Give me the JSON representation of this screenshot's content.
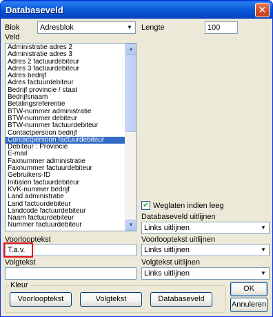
{
  "window": {
    "title": "Databaseveld",
    "close_symbol": "✕"
  },
  "blok": {
    "label": "Blok",
    "value": "Adresblok"
  },
  "lengte": {
    "label": "Lengte",
    "value": "100"
  },
  "veld": {
    "label": "Veld",
    "items": [
      "Administratie adres 2",
      "Administratie adres 3",
      "Adres 2 factuurdebiteur",
      "Adres 3 factuurdebiteur",
      "Adres bedrijf",
      "Adres factuurdebiteur",
      "Bedrijf provincie / staat",
      "Bedrijfsnaam",
      "Betalingsreferentie",
      "BTW-nummer administratie",
      "BTW-nummer debiteur",
      "BTW-nummer factuurdebiteur",
      "Contactpersoon bedrijf",
      "Contactpersoon factuurdebiteur",
      "Debiteur : Provincie",
      "E-mail",
      "Faxnummer administratie",
      "Faxnummer factuurdebiteur",
      "Gebruikers-ID",
      "Initialen factuurdebiteur",
      "KVK-nummer bedrijf",
      "Land administratie",
      "Land factuurdebiteur",
      "Landcode factuurdebiteur",
      "Naam factuurdebiteur",
      "Nummer factuurdebiteur"
    ],
    "selected_index": 13
  },
  "weglaten": {
    "label": "Weglaten indien leeg",
    "checked": "✔"
  },
  "databaseveld_uitlijnen": {
    "label": "Databaseveld uitlijnen",
    "value": "Links uitlijnen"
  },
  "voorlooptekst": {
    "label": "Voorlooptekst",
    "value": "T.a.v."
  },
  "voorlooptekst_uitlijnen": {
    "label": "Voorlooptekst uitlijnen",
    "value": "Links uitlijnen"
  },
  "volgtekst": {
    "label": "Volgtekst",
    "value": ""
  },
  "volgtekst_uitlijnen": {
    "label": "Volgtekst uitlijnen",
    "value": "Links uitlijnen"
  },
  "kleur": {
    "legend": "Kleur",
    "buttons": [
      "Voorlooptekst",
      "Volgtekst",
      "Databaseveld"
    ]
  },
  "buttons": {
    "ok": "OK",
    "cancel": "Annuleren"
  },
  "icons": {
    "dropdown": "▼",
    "scroll_up": "▲",
    "scroll_down": "▼"
  },
  "colors": {
    "selection": "#316ac5",
    "highlight": "#e8121a",
    "titlebar": "#0a58d8"
  }
}
